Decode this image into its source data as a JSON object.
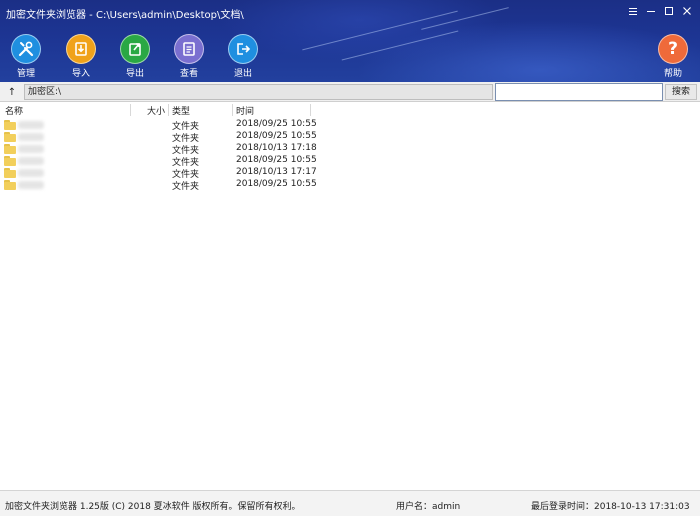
{
  "window": {
    "title": "加密文件夹浏览器 - C:\\Users\\admin\\Desktop\\文档\\",
    "controls": {
      "settings": "⁝",
      "minimize": "—",
      "maximize": "☐",
      "close": "✕"
    }
  },
  "toolbar": {
    "items": [
      {
        "label": "管理",
        "icon": "wrench-screwdriver-icon",
        "color": "#1f8fe0"
      },
      {
        "label": "导入",
        "icon": "import-icon",
        "color": "#f0a21a"
      },
      {
        "label": "导出",
        "icon": "export-icon",
        "color": "#2aa844"
      },
      {
        "label": "查看",
        "icon": "view-document-icon",
        "color": "#7a6fd0"
      },
      {
        "label": "退出",
        "icon": "exit-icon",
        "color": "#1f8fe0"
      }
    ],
    "help": {
      "label": "帮助",
      "icon": "help-icon",
      "color": "#ef6a3a",
      "glyph": "?"
    }
  },
  "address": {
    "up_label": "↑",
    "path": "加密区:\\",
    "search_value": "",
    "search_button": "搜索"
  },
  "list": {
    "columns": {
      "name": "名称",
      "size": "大小",
      "type": "类型",
      "time": "时间"
    },
    "rows": [
      {
        "type": "文件夹",
        "time": "2018/09/25 10:55"
      },
      {
        "type": "文件夹",
        "time": "2018/09/25 10:55"
      },
      {
        "type": "文件夹",
        "time": "2018/10/13 17:18"
      },
      {
        "type": "文件夹",
        "time": "2018/09/25 10:55"
      },
      {
        "type": "文件夹",
        "time": "2018/10/13 17:17"
      },
      {
        "type": "文件夹",
        "time": "2018/09/25 10:55"
      }
    ]
  },
  "statusbar": {
    "copyright": "加密文件夹浏览器 1.25版 (C) 2018 夏冰软件 版权所有。保留所有权利。",
    "user": "用户名：admin",
    "last_login": "最后登录时间：2018-10-13 17:31:03"
  }
}
